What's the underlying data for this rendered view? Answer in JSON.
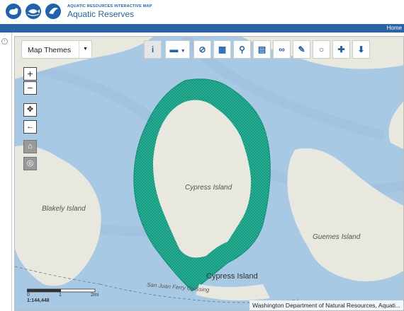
{
  "header": {
    "subtitle": "AQUATIC RESOURCES INTERACTIVE MAP",
    "title": "Aquatic Reserves",
    "logo_icons": [
      "seal-icon",
      "fish-icon",
      "bird-icon"
    ],
    "brand_color": "#1e63b0"
  },
  "nav": {
    "home_label": "Home",
    "bar_color": "#2a63a8"
  },
  "map": {
    "themes_label": "Map Themes",
    "toolbar_icons": [
      "info-icon",
      "rectangle-select-icon",
      "clear-icon",
      "layers-grid-icon",
      "search-icon",
      "book-icon",
      "link-icon",
      "wrench-icon",
      "comment-icon",
      "add-icon",
      "download-icon"
    ],
    "labels": {
      "cypress_italic": "Cypress Island",
      "cypress_plain": "Cypress Island",
      "blakely": "Blakely Island",
      "guemes": "Guemes Island",
      "ferry": "San Juan Ferry Crossing"
    },
    "scale": {
      "ticks": [
        "0",
        "1",
        "2mi"
      ],
      "ratio": "1:144,448"
    },
    "attribution": "Washington Department of Natural Resources, Aquati...",
    "colors": {
      "water": "#a7c9e3",
      "land": "#e9e8de",
      "reserve": "#1fa98c"
    }
  }
}
